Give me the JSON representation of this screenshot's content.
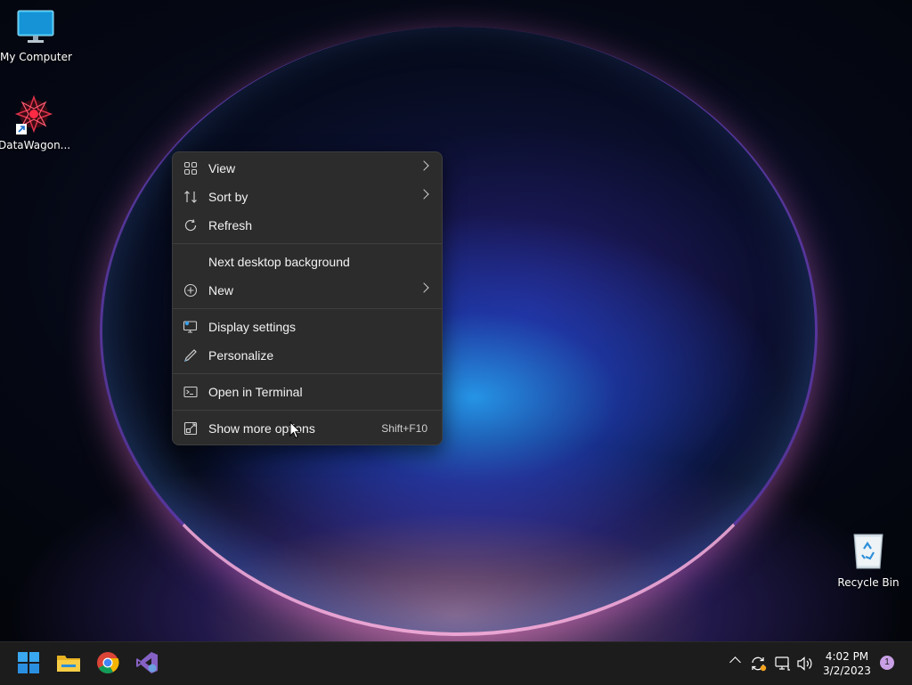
{
  "desktop_icons": {
    "my_computer": "My Computer",
    "datawagon": "DataWagon...",
    "recycle_bin": "Recycle Bin"
  },
  "context_menu": {
    "view": "View",
    "sort_by": "Sort by",
    "refresh": "Refresh",
    "next_background": "Next desktop background",
    "new": "New",
    "display_settings": "Display settings",
    "personalize": "Personalize",
    "open_terminal": "Open in Terminal",
    "show_more": "Show more options",
    "show_more_shortcut": "Shift+F10"
  },
  "taskbar": {
    "apps": [
      "start-icon",
      "file-explorer-icon",
      "chrome-icon",
      "visual-studio-icon"
    ],
    "time": "4:02 PM",
    "date": "3/2/2023",
    "notification_count": "1"
  },
  "colors": {
    "menu_bg": "#2c2c2c",
    "taskbar_bg": "#1c1c1c",
    "accent": "#c9a0e6"
  }
}
